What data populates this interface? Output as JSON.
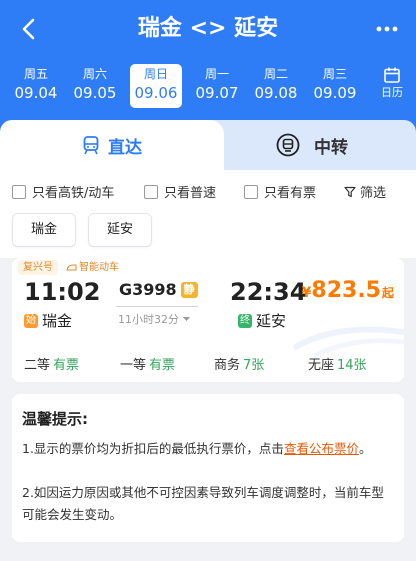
{
  "header": {
    "route": "瑞金 <> 延安",
    "colors": {
      "primary": "#2f7df6",
      "price": "#ff7a00",
      "available": "#35a65a"
    }
  },
  "dates": [
    {
      "weekday": "周五",
      "date": "09.04",
      "selected": false
    },
    {
      "weekday": "周六",
      "date": "09.05",
      "selected": false
    },
    {
      "weekday": "周日",
      "date": "09.06",
      "selected": true
    },
    {
      "weekday": "周一",
      "date": "09.07",
      "selected": false
    },
    {
      "weekday": "周二",
      "date": "09.08",
      "selected": false
    },
    {
      "weekday": "周三",
      "date": "09.09",
      "selected": false
    }
  ],
  "calendar_label": "日历",
  "tabs": {
    "direct": "直达",
    "transfer": "中转"
  },
  "filters": {
    "high_speed": "只看高铁/动车",
    "normal": "只看普速",
    "has_ticket": "只看有票",
    "filter": "筛选"
  },
  "stations_chips": [
    "瑞金",
    "延安"
  ],
  "train": {
    "tag_fuxing": "复兴号",
    "tag_smart": "智能动车",
    "depart_time": "11:02",
    "arrive_time": "22:34",
    "number": "G3998",
    "quiet_badge": "静",
    "duration": "11小时32分",
    "price_currency": "¥",
    "price": "823.5",
    "price_suffix": "起",
    "from_badge": "始",
    "from_station": "瑞金",
    "to_badge": "终",
    "to_station": "延安",
    "seats": [
      {
        "name": "二等",
        "availability": "有票"
      },
      {
        "name": "一等",
        "availability": "有票"
      },
      {
        "name": "商务",
        "availability": "7张"
      },
      {
        "name": "无座",
        "availability": "14张"
      }
    ]
  },
  "tips": {
    "title": "温馨提示:",
    "line1_a": "1.显示的票价均为折扣后的最低执行票价，点击",
    "line1_link": "查看公布票价",
    "line1_b": "。",
    "line2": "2.如因运力原因或其他不可控因素导致列车调度调整时，当前车型可能会发生变动。"
  }
}
